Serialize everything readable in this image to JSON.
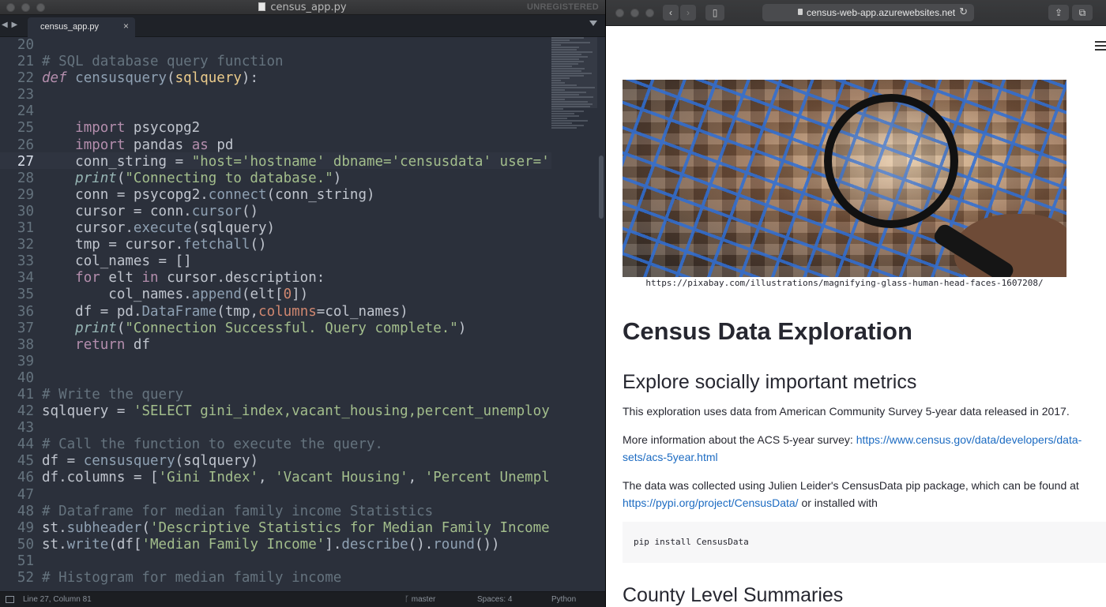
{
  "editor": {
    "window_title": "census_app.py",
    "unregistered_label": "UNREGISTERED",
    "tab": {
      "label": "census_app.py",
      "close": "×"
    },
    "tab_nav": "◀ ▶",
    "line_numbers": [
      "20",
      "21",
      "22",
      "23",
      "24",
      "25",
      "26",
      "27",
      "28",
      "29",
      "30",
      "31",
      "32",
      "33",
      "34",
      "35",
      "36",
      "37",
      "38",
      "39",
      "40",
      "41",
      "42",
      "43",
      "44",
      "45",
      "46",
      "47",
      "48",
      "49",
      "50",
      "51",
      "52"
    ],
    "current_line": "27",
    "code": {
      "l20": "",
      "l21_comment": "# SQL database query function",
      "l22_def": "def",
      "l22_fn": "censusquery",
      "l22_arg": "sqlquery",
      "l25_import": "import",
      "l25_mod": "psycopg2",
      "l26_import": "import",
      "l26_mod": "pandas",
      "l26_as": "as",
      "l26_alias": "pd",
      "l27_var": "conn_string",
      "l27_str": "\"host='hostname' dbname='censusdata' user='",
      "l28_print": "print",
      "l28_str": "\"Connecting to database.\"",
      "l29_var": "conn",
      "l29_mod": "psycopg2",
      "l29_meth": "connect",
      "l29_arg": "conn_string",
      "l30_var": "cursor",
      "l30_obj": "conn",
      "l30_meth": "cursor",
      "l31_obj": "cursor",
      "l31_meth": "execute",
      "l31_arg": "sqlquery",
      "l32_var": "tmp",
      "l32_obj": "cursor",
      "l32_meth": "fetchall",
      "l33_var": "col_names",
      "l34_for": "for",
      "l34_var": "elt",
      "l34_in": "in",
      "l34_obj": "cursor",
      "l34_attr": "description",
      "l35_obj": "col_names",
      "l35_meth": "append",
      "l35_arg": "elt",
      "l35_idx": "0",
      "l36_var": "df",
      "l36_obj": "pd",
      "l36_meth": "DataFrame",
      "l36_arg1": "tmp",
      "l36_kw": "columns",
      "l36_arg2": "col_names",
      "l37_print": "print",
      "l37_str": "\"Connection Successful. Query complete.\"",
      "l38_return": "return",
      "l38_var": "df",
      "l41_comment": "# Write the query",
      "l42_var": "sqlquery",
      "l42_str": "'SELECT gini_index,vacant_housing,percent_unemploy",
      "l44_comment": "# Call the function to execute the query.",
      "l45_var": "df",
      "l45_fn": "censusquery",
      "l45_arg": "sqlquery",
      "l46_obj": "df",
      "l46_attr": "columns",
      "l46_str1": "'Gini Index'",
      "l46_str2": "'Vacant Housing'",
      "l46_str3": "'Percent Unempl",
      "l48_comment": "# Dataframe for median family income Statistics",
      "l49_obj": "st",
      "l49_meth": "subheader",
      "l49_str": "'Descriptive Statistics for Median Family Income",
      "l50_obj": "st",
      "l50_meth": "write",
      "l50_arg": "df",
      "l50_str": "'Median Family Income'",
      "l50_meth2": "describe",
      "l50_meth3": "round",
      "l52_comment": "# Histogram for median family income"
    },
    "status": {
      "position": "Line 27, Column 81",
      "branch": "ᚴ master",
      "spaces": "Spaces: 4",
      "syntax": "Python"
    }
  },
  "browser": {
    "url": "census-web-app.azurewebsites.net",
    "page": {
      "image_caption": "https://pixabay.com/illustrations/magnifying-glass-human-head-faces-1607208/",
      "title": "Census Data Exploration",
      "subtitle": "Explore socially important metrics",
      "p1": "This exploration uses data from American Community Survey 5-year data released in 2017.",
      "p2_text": "More information about the ACS 5-year survey: ",
      "p2_link": "https://www.census.gov/data/developers/data-sets/acs-5year.html",
      "p3_text": "The data was collected using Julien Leider's CensusData pip package, which can be found at ",
      "p3_link": "https://pypi.org/project/CensusData/",
      "p3_tail": " or installed with",
      "code": "pip install CensusData",
      "section2": "County Level Summaries"
    }
  }
}
